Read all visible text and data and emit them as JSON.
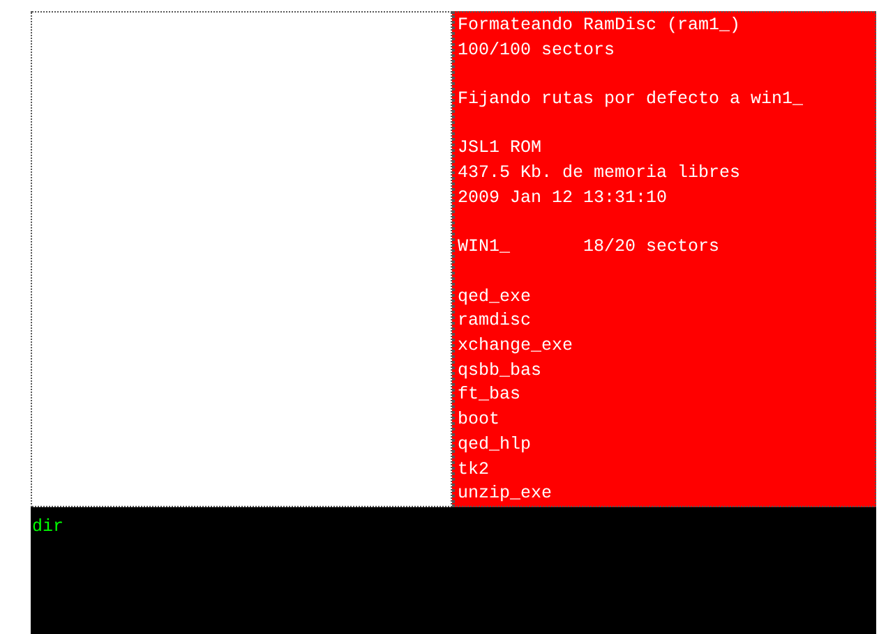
{
  "output_window": {
    "blocks": [
      {
        "lines": [
          "Formateando RamDisc (ram1_)",
          "100/100 sectors"
        ]
      },
      {
        "lines": [
          "Fijando rutas por defecto a win1_"
        ]
      },
      {
        "lines": [
          "JSL1 ROM",
          "437.5 Kb. de memoria libres",
          "2009 Jan 12 13:31:10"
        ]
      },
      {
        "lines": [
          "WIN1_       18/20 sectors"
        ]
      },
      {
        "lines": [
          "qed_exe",
          "ramdisc",
          "xchange_exe",
          "qsbb_bas",
          "ft_bas",
          "boot",
          "qed_hlp",
          "tk2",
          "unzip_exe"
        ]
      }
    ]
  },
  "command_window": {
    "input": "dir"
  }
}
